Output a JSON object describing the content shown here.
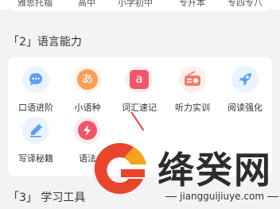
{
  "top_row": [
    "雅思托福",
    "高中",
    "小学初中",
    "专升本",
    "专四专八"
  ],
  "sections": [
    {
      "title": "「2」语言能力"
    },
    {
      "title": "「3」 学习工具"
    }
  ],
  "items": [
    {
      "label": "口语进阶",
      "icon": "chat-bubble-icon",
      "color": "#5aa0f5"
    },
    {
      "label": "小语种",
      "icon": "hiragana-a-icon",
      "color": "#f5a05a"
    },
    {
      "label": "词汇速记",
      "icon": "letter-a-icon",
      "color": "#f0566a"
    },
    {
      "label": "听力实训",
      "icon": "radio-icon",
      "color": "#f57a6a"
    },
    {
      "label": "阅读强化",
      "icon": "rocket-icon",
      "color": "#5aa0f5"
    },
    {
      "label": "写译秘籍",
      "icon": "pen-icon",
      "color": "#5aa0f5"
    },
    {
      "label": "语法",
      "icon": "lightning-icon",
      "color": "#f0566a"
    }
  ],
  "watermark": {
    "title": "绛癸网",
    "url": "jiangguijiuye.com"
  }
}
